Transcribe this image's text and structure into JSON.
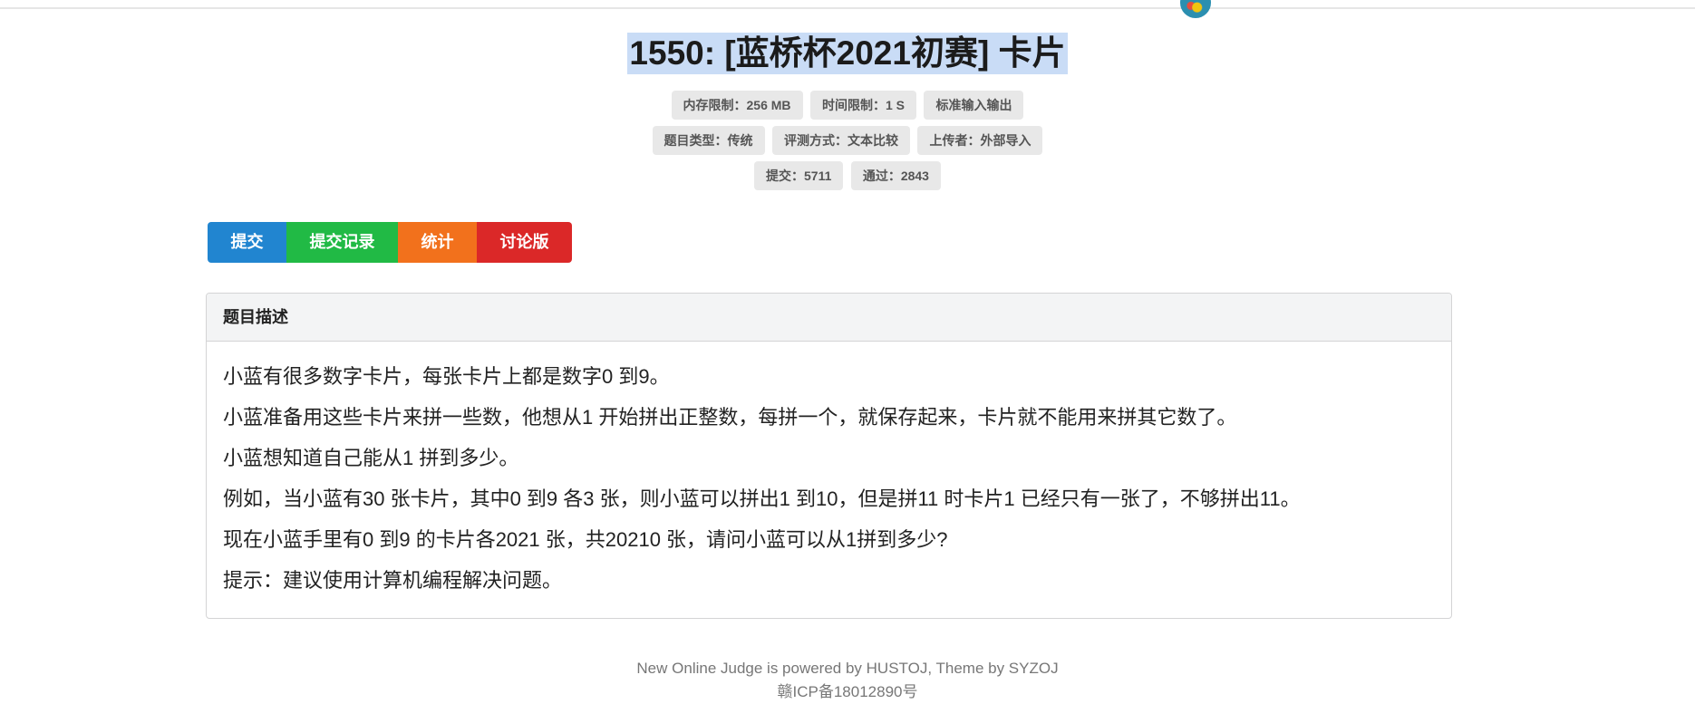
{
  "header": {
    "avatar_icon": "user-avatar-icon"
  },
  "problem": {
    "title": "1550: [蓝桥杯2021初赛] 卡片",
    "labels_row1": [
      "内存限制：256 MB",
      "时间限制：1 S",
      "标准输入输出"
    ],
    "labels_row2": [
      "题目类型：传统",
      "评测方式：文本比较",
      "上传者：外部导入"
    ],
    "labels_row3": [
      "提交：5711",
      "通过：2843"
    ]
  },
  "actions": {
    "submit": "提交",
    "records": "提交记录",
    "stats": "统计",
    "discuss": "讨论版",
    "colors": {
      "submit": "#2185d0",
      "records": "#21ba45",
      "stats": "#f2711c",
      "discuss": "#db2828"
    }
  },
  "description": {
    "header": "题目描述",
    "paragraphs": [
      "小蓝有很多数字卡片，每张卡片上都是数字0 到9。",
      "小蓝准备用这些卡片来拼一些数，他想从1 开始拼出正整数，每拼一个，就保存起来，卡片就不能用来拼其它数了。",
      "小蓝想知道自己能从1 拼到多少。",
      "例如，当小蓝有30 张卡片，其中0 到9 各3 张，则小蓝可以拼出1 到10，但是拼11 时卡片1 已经只有一张了，不够拼出11。",
      "现在小蓝手里有0 到9 的卡片各2021 张，共20210 张，请问小蓝可以从1拼到多少?",
      "提示：建议使用计算机编程解决问题。"
    ]
  },
  "footer": {
    "line1": "New Online Judge is powered by HUSTOJ, Theme by SYZOJ",
    "line2": "赣ICP备18012890号"
  }
}
